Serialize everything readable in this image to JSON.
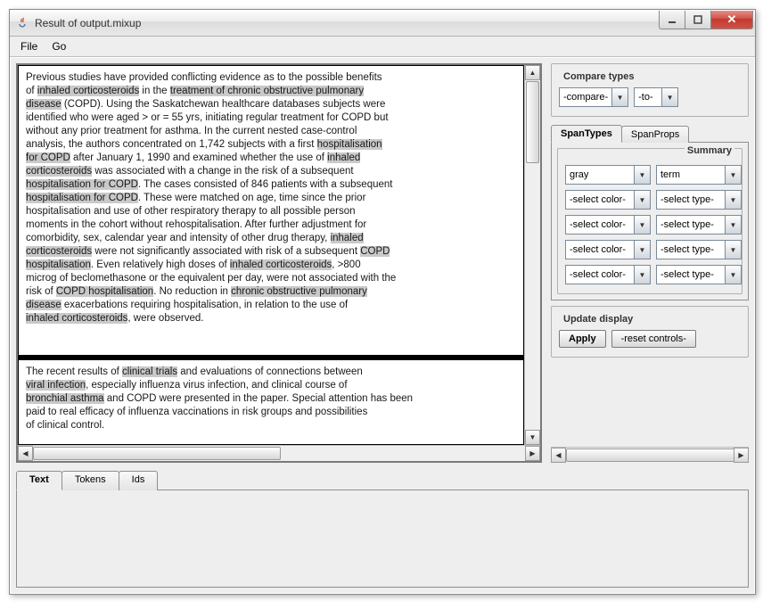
{
  "window": {
    "title": "Result of output.mixup"
  },
  "menu": {
    "file": "File",
    "go": "Go"
  },
  "text_block_1": {
    "t01": "Previous studies have provided conflicting evidence as to the possible benefits",
    "t02": "of ",
    "h02": "inhaled corticosteroids",
    "t03": " in the ",
    "h03": "treatment of chronic obstructive pulmonary",
    "h04": "disease",
    "t05": " (COPD). Using the Saskatchewan healthcare databases subjects were",
    "t06": "identified who were aged > or = 55 yrs, initiating regular treatment for COPD but",
    "t07": "without any prior treatment for asthma. In the current nested case-control",
    "t08": "analysis, the authors concentrated on 1,742 subjects with a first ",
    "h08": "hospitalisation",
    "h09": "for COPD",
    "t09": " after January 1, 1990 and examined whether the use of ",
    "h09b": "inhaled",
    "h10": "corticosteroids",
    "t10": " was associated with a change in the risk of a subsequent",
    "h11": "hospitalisation for COPD",
    "t11": ". The cases consisted of 846 patients with a subsequent",
    "h12": "hospitalisation for COPD",
    "t12": ". These were matched on age, time since the prior",
    "t13": "hospitalisation and use of other respiratory therapy to all possible person",
    "t14": "moments in the cohort without rehospitalisation. After further adjustment for",
    "t15": "comorbidity, sex, calendar year and intensity of other drug therapy, ",
    "h15": "inhaled",
    "h16": "corticosteroids",
    "t16": " were not significantly associated with risk of a subsequent ",
    "h16b": "COPD",
    "h17": "hospitalisation",
    "t17": ". Even relatively high doses of ",
    "h17b": "inhaled corticosteroids",
    "t17c": ", >800",
    "t18": "microg of beclomethasone or the equivalent per day, were not associated with the",
    "t19": "risk of ",
    "h19": "COPD hospitalisation",
    "t19b": ". No reduction in ",
    "h19c": "chronic obstructive pulmonary",
    "h20": "disease",
    "t20": " exacerbations requiring hospitalisation, in relation to the use of",
    "h21": "inhaled corticosteroids",
    "t21": ", were observed."
  },
  "text_block_2": {
    "t01": "The recent results of ",
    "h01": "clinical trials",
    "t01b": " and evaluations of connections between",
    "h02": "viral infection",
    "t02": ", especially influenza virus infection, and clinical course of",
    "h03": "bronchial asthma",
    "t03": " and COPD were presented in the paper. Special attention has been",
    "t04": "paid to real efficacy of influenza vaccinations in risk groups and possibilities",
    "t05": "of clinical control."
  },
  "compare": {
    "legend": "Compare types",
    "left": "-compare-",
    "right": "-to-"
  },
  "spans": {
    "tab_types": "SpanTypes",
    "tab_props": "SpanProps",
    "summary": "Summary",
    "row1_color": "gray",
    "row1_type": "term",
    "ph_color": "-select color-",
    "ph_type": "-select type-"
  },
  "update": {
    "legend": "Update display",
    "apply": "Apply",
    "reset": "-reset controls-"
  },
  "bottom_tabs": {
    "text": "Text",
    "tokens": "Tokens",
    "ids": "Ids"
  }
}
